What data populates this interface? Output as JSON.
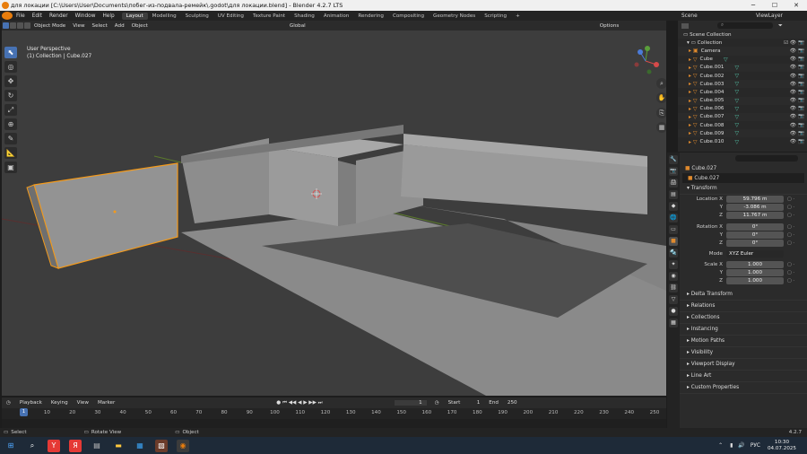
{
  "window": {
    "title": "для локации [C:\\Users\\User\\Documents\\побег-из-подвала-ремейк\\.godot\\для локации.blend] - Blender 4.2.7 LTS"
  },
  "menu": [
    "File",
    "Edit",
    "Render",
    "Window",
    "Help"
  ],
  "workspaces": [
    "Layout",
    "Modelling",
    "Sculpting",
    "UV Editing",
    "Texture Paint",
    "Shading",
    "Animation",
    "Rendering",
    "Compositing",
    "Geometry Nodes",
    "Scripting",
    "+"
  ],
  "scene": {
    "label": "Scene",
    "view_layer": "ViewLayer"
  },
  "viewport_header": {
    "mode": "Object Mode",
    "view": "View",
    "select": "Select",
    "add": "Add",
    "object": "Object",
    "transform": "Global",
    "options": "Options"
  },
  "overlay": {
    "line1": "User Perspective",
    "line2": "(1) Collection | Cube.027"
  },
  "timeline": {
    "playback": "Playback",
    "keying": "Keying",
    "view": "View",
    "marker": "Marker",
    "current": "1",
    "start_label": "Start",
    "start": "1",
    "end_label": "End",
    "end": "250",
    "ticks": [
      "1",
      "10",
      "20",
      "30",
      "40",
      "50",
      "60",
      "70",
      "80",
      "90",
      "100",
      "110",
      "120",
      "130",
      "140",
      "150",
      "160",
      "170",
      "180",
      "190",
      "200",
      "210",
      "220",
      "230",
      "240",
      "250"
    ]
  },
  "status": {
    "select": "Select",
    "rotate": "Rotate View",
    "object": "Object",
    "version": "4.2.7"
  },
  "outliner": {
    "search_placeholder": "",
    "scene_collection": "Scene Collection",
    "collection": "Collection",
    "items": [
      "Camera",
      "Cube",
      "Cube.001",
      "Cube.002",
      "Cube.003",
      "Cube.004",
      "Cube.005",
      "Cube.006",
      "Cube.007",
      "Cube.008",
      "Cube.009",
      "Cube.010"
    ]
  },
  "properties": {
    "object": "Cube.027",
    "object_name": "Cube.027",
    "transform": "Transform",
    "location_label": "Location X",
    "loc_y_label": "Y",
    "loc_z_label": "Z",
    "location": [
      "59.796 m",
      "-3.086 m",
      "11.767 m"
    ],
    "rotation_label": "Rotation X",
    "rot_y_label": "Y",
    "rot_z_label": "Z",
    "rotation": [
      "0°",
      "0°",
      "0°"
    ],
    "mode_label": "Mode",
    "mode": "XYZ Euler",
    "scale_label": "Scale X",
    "scale_y_label": "Y",
    "scale_z_label": "Z",
    "scale": [
      "1.000",
      "1.000",
      "1.000"
    ],
    "sections": [
      "Delta Transform",
      "Relations",
      "Collections",
      "Instancing",
      "Motion Paths",
      "Visibility",
      "Viewport Display",
      "Line Art",
      "Custom Properties"
    ]
  },
  "taskbar": {
    "lang": "РУС",
    "time": "10:30",
    "date": "04.07.2025"
  },
  "colors": {
    "accent": "#4772b3",
    "selected_outline": "#f39a1c",
    "mesh_icon": "#54c4a8",
    "viewport_bg": "#3d3d3d"
  }
}
